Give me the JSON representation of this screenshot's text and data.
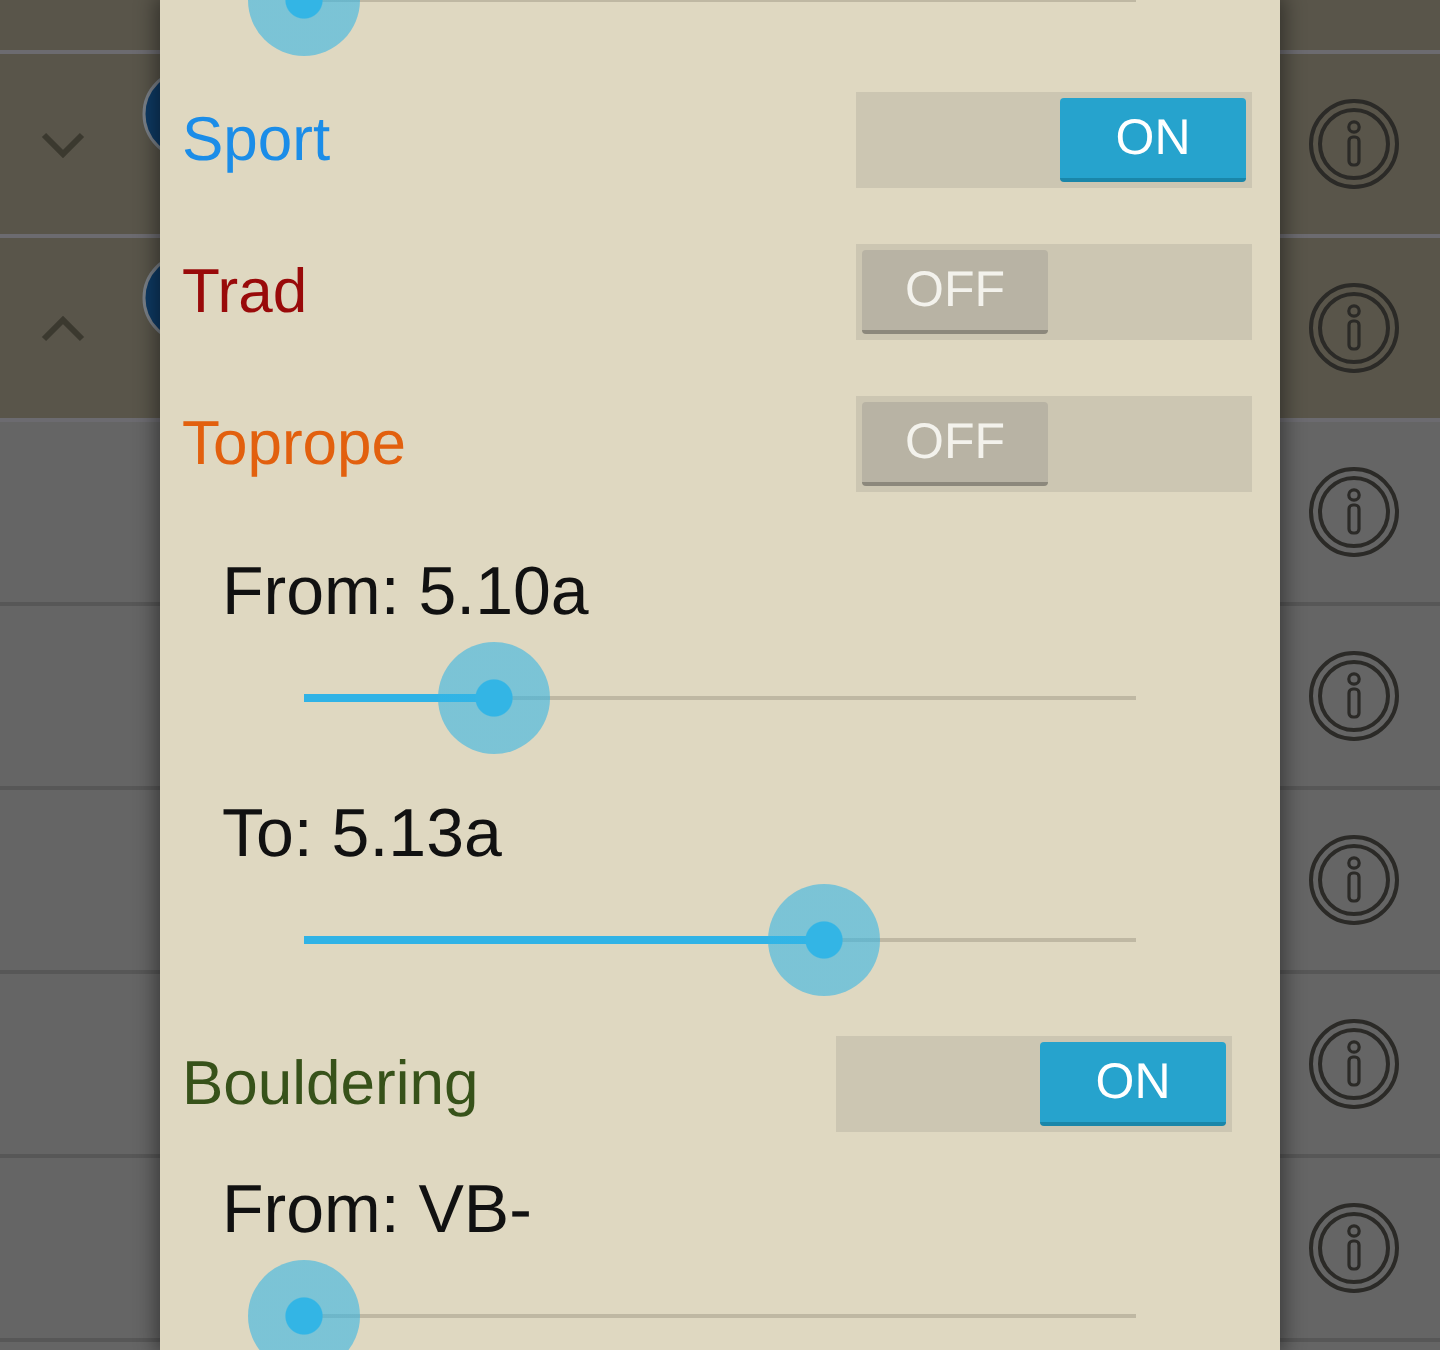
{
  "list": {
    "rows": [
      {
        "kind": "group",
        "avatar": false,
        "info": false
      },
      {
        "kind": "group",
        "expanded": false,
        "avatar": true,
        "info": true
      },
      {
        "kind": "group",
        "expanded": true,
        "avatar": true,
        "info": true
      },
      {
        "kind": "item",
        "avatar": false,
        "info": true
      },
      {
        "kind": "item",
        "avatar": false,
        "info": true
      },
      {
        "kind": "item",
        "avatar": false,
        "info": true
      },
      {
        "kind": "item",
        "avatar": false,
        "info": true
      },
      {
        "kind": "item",
        "avatar": false,
        "info": true
      }
    ]
  },
  "dialog": {
    "groups": [
      {
        "items": [
          {
            "kind": "slider",
            "level": 0
          }
        ]
      },
      {
        "items": [
          {
            "kind": "toggle",
            "label": "Sport",
            "color": "#1b8de8",
            "switch": {
              "on": true,
              "text": "ON"
            }
          },
          {
            "kind": "toggle",
            "label": "Trad",
            "color": "#990a0a",
            "switch": {
              "on": false,
              "text": "OFF"
            }
          },
          {
            "kind": "toggle",
            "label": "Toprope",
            "color": "#e2600e",
            "switch": {
              "on": false,
              "text": "OFF"
            }
          },
          {
            "kind": "slider",
            "label": "From: 5.10a",
            "level": 0.228
          },
          {
            "kind": "slider",
            "label": "To: 5.13a",
            "level": 0.625
          }
        ]
      },
      {
        "items": [
          {
            "kind": "toggle",
            "label": "Bouldering",
            "color": "#37521a",
            "switch": {
              "on": true,
              "text": "ON"
            }
          },
          {
            "kind": "slider",
            "label": "From: VB-",
            "level": 0
          }
        ]
      }
    ]
  }
}
